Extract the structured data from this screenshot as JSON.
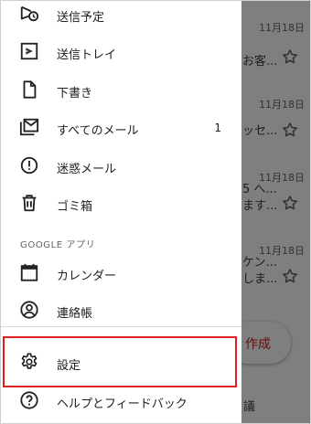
{
  "background": {
    "rows": [
      {
        "date": "11月18日",
        "snippet": ""
      },
      {
        "date": "",
        "snippet": "お客..."
      },
      {
        "date": "11月18日",
        "snippet": "ッセ..."
      },
      {
        "date": "11月18日",
        "snippet": "5 へ..."
      },
      {
        "date": "",
        "snippet": "ます..."
      },
      {
        "date": "11月18日",
        "snippet": "ケン..."
      },
      {
        "date": "",
        "snippet": "しま..."
      }
    ],
    "compose_label": "作成",
    "bottom_snippet": "議"
  },
  "drawer": {
    "items": [
      {
        "label": "送信予定",
        "icon": "scheduled-send-icon"
      },
      {
        "label": "送信トレイ",
        "icon": "outbox-icon"
      },
      {
        "label": "下書き",
        "icon": "draft-icon"
      },
      {
        "label": "すべてのメール",
        "icon": "all-mail-icon",
        "count": "1"
      },
      {
        "label": "迷惑メール",
        "icon": "spam-icon"
      },
      {
        "label": "ゴミ箱",
        "icon": "trash-icon"
      }
    ],
    "section_header": "GOOGLE アプリ",
    "google_apps": [
      {
        "label": "カレンダー",
        "icon": "calendar-icon"
      },
      {
        "label": "連絡帳",
        "icon": "contacts-icon"
      }
    ],
    "settings_label": "設定",
    "help_label": "ヘルプとフィードバック"
  },
  "colors": {
    "highlight": "#e02020",
    "compose_text": "#c5221f",
    "scrim": "rgba(0,0,0,0.5)"
  }
}
